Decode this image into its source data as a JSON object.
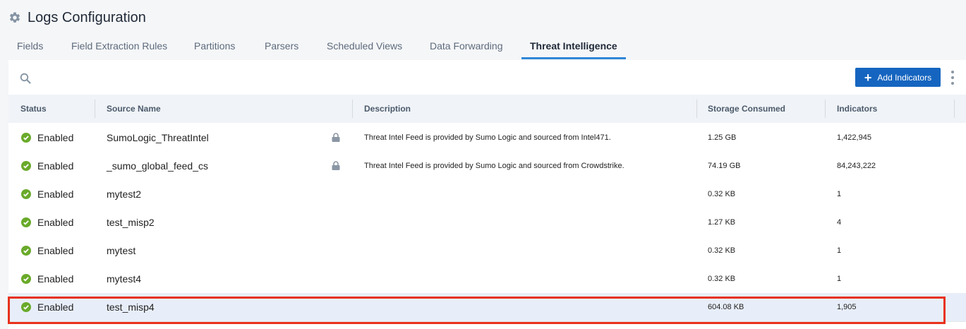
{
  "header": {
    "title": "Logs Configuration",
    "icon": "gear-icon"
  },
  "tabs": [
    {
      "label": "Fields",
      "active": false
    },
    {
      "label": "Field Extraction Rules",
      "active": false
    },
    {
      "label": "Partitions",
      "active": false
    },
    {
      "label": "Parsers",
      "active": false
    },
    {
      "label": "Scheduled Views",
      "active": false
    },
    {
      "label": "Data Forwarding",
      "active": false
    },
    {
      "label": "Threat Intelligence",
      "active": true
    }
  ],
  "toolbar": {
    "search_icon": "search-icon",
    "add_label": "Add Indicators",
    "more_icon": "kebab-menu-icon"
  },
  "table": {
    "columns": [
      "Status",
      "Source Name",
      "Description",
      "Storage Consumed",
      "Indicators"
    ],
    "rows": [
      {
        "status": "Enabled",
        "source": "SumoLogic_ThreatIntel",
        "locked": true,
        "description": "Threat Intel Feed is provided by Sumo Logic and sourced from Intel471.",
        "storage": "1.25 GB",
        "indicators": "1,422,945"
      },
      {
        "status": "Enabled",
        "source": "_sumo_global_feed_cs",
        "locked": true,
        "description": "Threat Intel Feed is provided by Sumo Logic and sourced from Crowdstrike.",
        "storage": "74.19 GB",
        "indicators": "84,243,222"
      },
      {
        "status": "Enabled",
        "source": "mytest2",
        "locked": false,
        "description": "",
        "storage": "0.32 KB",
        "indicators": "1"
      },
      {
        "status": "Enabled",
        "source": "test_misp2",
        "locked": false,
        "description": "",
        "storage": "1.27 KB",
        "indicators": "4"
      },
      {
        "status": "Enabled",
        "source": "mytest",
        "locked": false,
        "description": "",
        "storage": "0.32 KB",
        "indicators": "1"
      },
      {
        "status": "Enabled",
        "source": "mytest4",
        "locked": false,
        "description": "",
        "storage": "0.32 KB",
        "indicators": "1"
      },
      {
        "status": "Enabled",
        "source": "test_misp4",
        "locked": false,
        "description": "",
        "storage": "604.08 KB",
        "indicators": "1,905",
        "selected": true
      }
    ]
  },
  "colors": {
    "accent": "#2f87d8",
    "button": "#1565c0",
    "status_ok": "#6aaa2a",
    "highlight_border": "#e8321c",
    "selected_row": "#e8eef9"
  }
}
